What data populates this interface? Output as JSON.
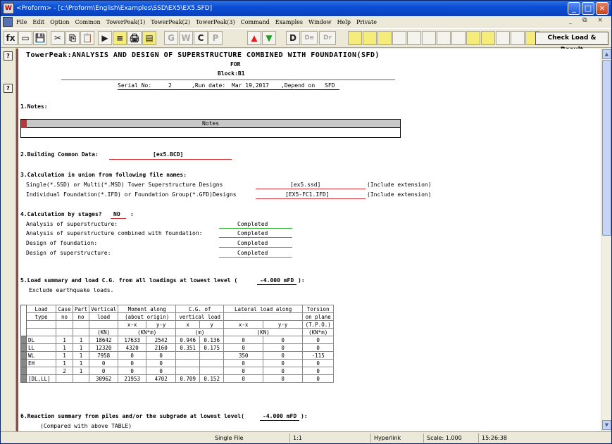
{
  "window": {
    "title": "<Proform> - [c:\\Proform\\English\\Examples\\SSD\\EX5\\EX5.SFD]",
    "app_icon_label": "W",
    "min_label": "_",
    "max_label": "□",
    "close_label": "×"
  },
  "menu": {
    "items": [
      "File",
      "Edit",
      "Option",
      "Common",
      "TowerPeak(1)",
      "TowerPeak(2)",
      "TowerPeak(3)",
      "Command",
      "Examples",
      "Window",
      "Help",
      "Private"
    ],
    "mdi_controls": "_ ⧉ ×"
  },
  "toolbar": {
    "buttons": [
      "fx",
      "▭",
      "💾",
      "✂",
      "⎘",
      "📋",
      "▶",
      "≡",
      "🖨",
      "▤",
      "G",
      "W",
      "C",
      "P",
      "▲",
      "▼",
      "D",
      "De",
      "Dr"
    ],
    "check_label": "Check Load & Result"
  },
  "gutter": {
    "btn1": "?",
    "btn2": "?"
  },
  "doc": {
    "title": "TowerPeak:ANALYSIS AND DESIGN OF SUPERSTRUCTURE COMBINED WITH FOUNDATION(SFD)",
    "for": "FOR",
    "block": "Block:B1",
    "serial_label": "Serial No:",
    "serial_value": "2",
    "run_label": ",Run date:",
    "run_value": "Mar 19,2017",
    "depend_label": ",Depend on",
    "depend_value": "SFD",
    "s1": "1.Notes:",
    "notes_header": "Notes",
    "s2_label": "2.Building Common Data:",
    "s2_value": "[ex5.BCD]",
    "s3": "3.Calculation in union from following file names:",
    "s3_l1": "Single(*.SSD) or Multi(*.MSD) Tower Superstructure Designs",
    "s3_v1": "[ex5.ssd]",
    "s3_e1": "(Include extension)",
    "s3_l2": "Individual Foundation(*.IFD) or Foundation Group(*.GFD)Designs",
    "s3_v2": "[EX5-FC1.IFD]",
    "s3_e2": "(Include extension)",
    "s4_label": "4.Calculation by stages?",
    "s4_value": "NO",
    "s4_colon": ":",
    "s4_items": [
      {
        "label": "Analysis of superstructure:",
        "value": "Completed"
      },
      {
        "label": "Analysis of superstructure combined with foundation:",
        "value": "Completed"
      },
      {
        "label": "Design of foundation:",
        "value": "Completed"
      },
      {
        "label": "Design of superstructure:",
        "value": "Completed"
      }
    ],
    "s5_label": "5.Load summary and load C.G. from all loadings at lowest level (",
    "s5_value": "-4.000 mFD",
    "s5_end": "):",
    "s5_note": "Exclude earthquake loads.",
    "s6_label": "6.Reaction summary from piles and/or the subgrade at lowest level(",
    "s6_value": "-4.000 mFD",
    "s6_end": "):",
    "s6_note": "(Compared with above TABLE)"
  },
  "table": {
    "h1": [
      "Load",
      "Case",
      "Part",
      "Vertical",
      "Moment along",
      "C.G. of",
      "Lateral load along",
      "Torsion"
    ],
    "h2": [
      "type",
      "no",
      "no",
      "load",
      "(about origin)",
      "vertical load",
      "",
      "on plane"
    ],
    "h3": [
      "",
      "",
      "",
      "",
      "x-x",
      "y-y",
      "x",
      "y",
      "x-x",
      "y-y",
      "(T.P.O.)"
    ],
    "h4": [
      "",
      "",
      "",
      "(KN)",
      "(KN*m)",
      "(m)",
      "(KN)",
      "(KN*m)"
    ],
    "rows": [
      [
        "DL",
        "1",
        "1",
        "18642",
        "17633",
        "2542",
        "0.946",
        "0.136",
        "0",
        "0",
        "0"
      ],
      [
        "LL",
        "1",
        "1",
        "12320",
        "4320",
        "2160",
        "0.351",
        "0.175",
        "0",
        "0",
        "0"
      ],
      [
        "WL",
        "1",
        "1",
        "7958",
        "0",
        "0",
        "",
        "",
        "350",
        "0",
        "-115"
      ],
      [
        "EH",
        "1",
        "1",
        "0",
        "0",
        "0",
        "",
        "",
        "0",
        "0",
        "0"
      ],
      [
        "",
        "2",
        "1",
        "0",
        "0",
        "0",
        "",
        "",
        "0",
        "0",
        "0"
      ],
      [
        "[DL,LL]",
        "",
        "",
        "30962",
        "21953",
        "4702",
        "0.709",
        "0.152",
        "0",
        "0",
        "0"
      ]
    ]
  },
  "status": {
    "mode": "Single File",
    "pos": "1:1",
    "link": "Hyperlink",
    "scale": "Scale: 1.000",
    "time": "15:26:38"
  },
  "scroll": {
    "up": "▲",
    "down": "▼"
  }
}
